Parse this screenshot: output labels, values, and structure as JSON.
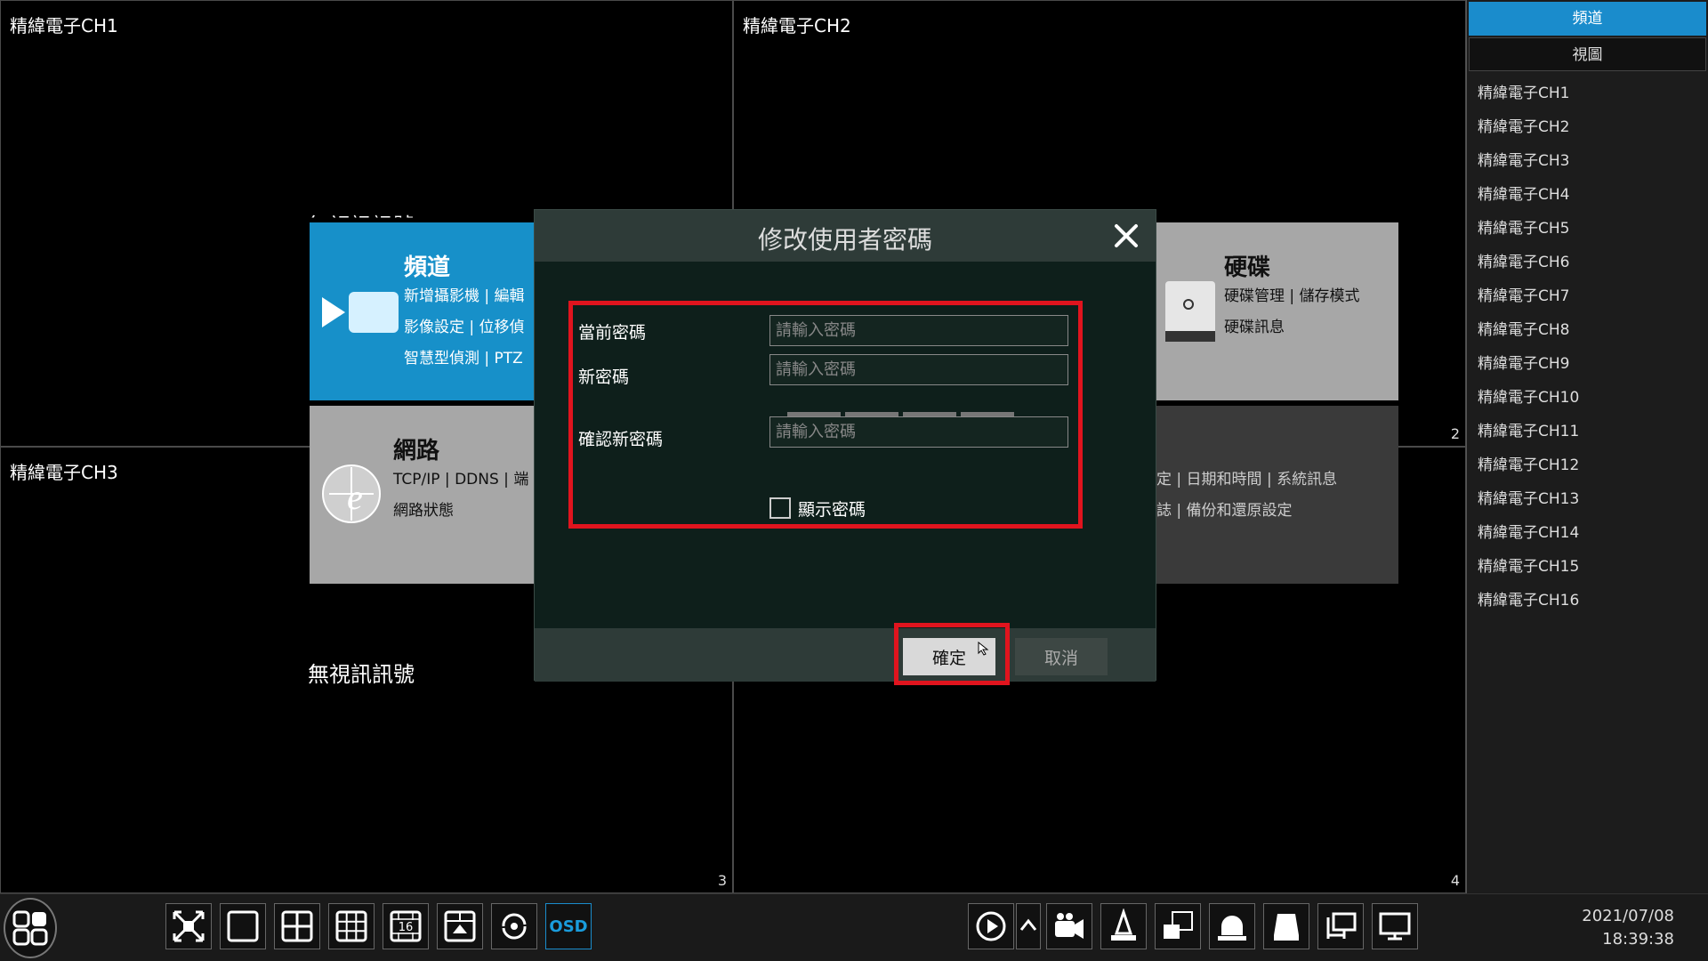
{
  "grid": {
    "channels": [
      {
        "title": "精緯電子CH1",
        "num": ""
      },
      {
        "title": "精緯電子CH2",
        "num": "2"
      },
      {
        "title": "精緯電子CH3",
        "num": "3"
      },
      {
        "title": "",
        "num": "4"
      }
    ],
    "no_signal": "無視訊訊號",
    "no_signal_top": "無視訊訊號"
  },
  "tiles": {
    "channel": {
      "title": "頻道",
      "row1a": "新增攝影機",
      "row1b": "編輯",
      "row2a": "影像設定",
      "row2b": "位移偵",
      "row3a": "智慧型偵測",
      "row3b": "PTZ"
    },
    "network": {
      "title": "網路",
      "row1a": "TCP/IP",
      "row1b": "DDNS",
      "row1c": "端",
      "row2a": "網路狀態"
    },
    "disk": {
      "title": "硬碟",
      "row1a": "硬碟管理",
      "row1b": "儲存模式",
      "row2a": "硬碟訊息"
    },
    "system": {
      "row1a": "定",
      "row1b": "日期和時間",
      "row1c": "系統訊息",
      "row2a": "誌",
      "row2b": "備份和還原設定"
    }
  },
  "sidebar": {
    "tab_channel": "頻道",
    "tab_view": "視圖",
    "items": [
      "精緯電子CH1",
      "精緯電子CH2",
      "精緯電子CH3",
      "精緯電子CH4",
      "精緯電子CH5",
      "精緯電子CH6",
      "精緯電子CH7",
      "精緯電子CH8",
      "精緯電子CH9",
      "精緯電子CH10",
      "精緯電子CH11",
      "精緯電子CH12",
      "精緯電子CH13",
      "精緯電子CH14",
      "精緯電子CH15",
      "精緯電子CH16"
    ]
  },
  "dialog": {
    "title": "修改使用者密碼",
    "current_label": "當前密碼",
    "new_label": "新密碼",
    "confirm_label": "確認新密碼",
    "placeholder": "請輸入密碼",
    "show_password": "顯示密碼",
    "ok": "確定",
    "cancel": "取消"
  },
  "toolbar": {
    "osd": "OSD",
    "layout16": "16",
    "date": "2021/07/08",
    "time": "18:39:38"
  },
  "colors": {
    "accent": "#1a8ccc",
    "highlight": "#e0141e",
    "dialog_bg": "#0e1f1b"
  }
}
